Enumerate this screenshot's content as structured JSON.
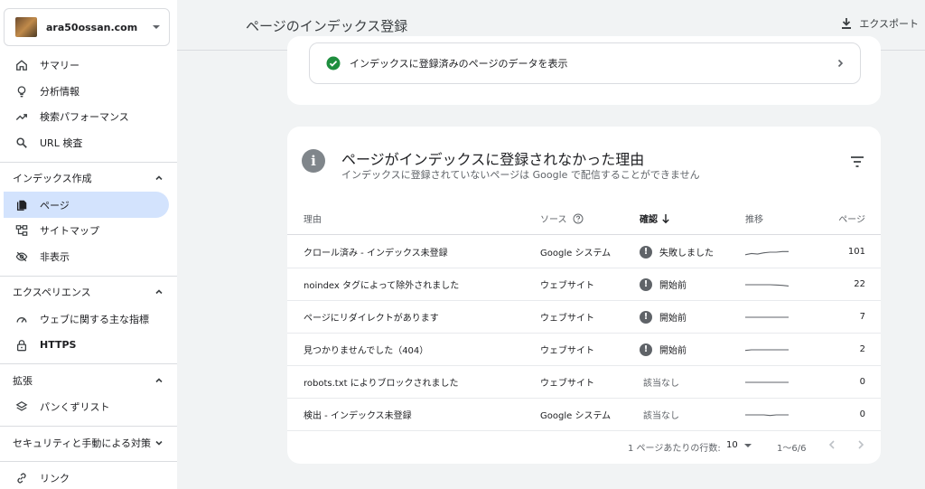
{
  "property": {
    "name": "ara50ossan.com"
  },
  "sidebar": {
    "items": [
      {
        "label": "サマリー",
        "icon": "home-icon"
      },
      {
        "label": "分析情報",
        "icon": "lightbulb-icon"
      },
      {
        "label": "検索パフォーマンス",
        "icon": "trending-up-icon"
      },
      {
        "label": "URL 検査",
        "icon": "search-icon"
      }
    ],
    "sections": [
      {
        "label": "インデックス作成",
        "items": [
          {
            "label": "ページ",
            "icon": "page-icon",
            "active": true
          },
          {
            "label": "サイトマップ",
            "icon": "sitemap-icon"
          },
          {
            "label": "非表示",
            "icon": "eye-off-icon"
          }
        ]
      },
      {
        "label": "エクスペリエンス",
        "items": [
          {
            "label": "ウェブに関する主な指標",
            "icon": "gauge-icon"
          },
          {
            "label": "HTTPS",
            "icon": "lock-icon"
          }
        ]
      },
      {
        "label": "拡張",
        "items": [
          {
            "label": "パンくずリスト",
            "icon": "layers-icon"
          }
        ]
      },
      {
        "label": "セキュリティと手動による対策",
        "items": []
      }
    ],
    "bottom_items": [
      {
        "label": "リンク",
        "icon": "link-icon"
      }
    ]
  },
  "header": {
    "title": "ページのインデックス登録",
    "export_label": "エクスポート"
  },
  "indexed_link": {
    "label": "インデックスに登録済みのページのデータを表示"
  },
  "reasons_card": {
    "title": "ページがインデックスに登録されなかった理由",
    "subtitle": "インデックスに登録されていないページは Google で配信することができません",
    "columns": {
      "reason": "理由",
      "source": "ソース",
      "status": "確認",
      "trend": "推移",
      "pages": "ページ"
    },
    "rows": [
      {
        "reason": "クロール済み - インデックス未登録",
        "source": "Google システム",
        "status": "失敗しました",
        "status_alert": true,
        "pages": "101",
        "trend": [
          0.3,
          0.4,
          0.35,
          0.45,
          0.5,
          0.5,
          0.55,
          0.55
        ]
      },
      {
        "reason": "noindex タグによって除外されました",
        "source": "ウェブサイト",
        "status": "開始前",
        "status_alert": true,
        "pages": "22",
        "trend": [
          0.5,
          0.5,
          0.5,
          0.5,
          0.5,
          0.48,
          0.45,
          0.4
        ]
      },
      {
        "reason": "ページにリダイレクトがあります",
        "source": "ウェブサイト",
        "status": "開始前",
        "status_alert": true,
        "pages": "7",
        "trend": [
          0.5,
          0.5,
          0.5,
          0.5,
          0.5,
          0.5,
          0.5,
          0.5
        ]
      },
      {
        "reason": "見つかりませんでした（404）",
        "source": "ウェブサイト",
        "status": "開始前",
        "status_alert": true,
        "pages": "2",
        "trend": [
          0.45,
          0.5,
          0.5,
          0.5,
          0.5,
          0.5,
          0.5,
          0.5
        ]
      },
      {
        "reason": "robots.txt によりブロックされました",
        "source": "ウェブサイト",
        "status": "該当なし",
        "status_alert": false,
        "pages": "0",
        "trend": [
          0.5,
          0.5,
          0.5,
          0.5,
          0.5,
          0.5,
          0.5,
          0.5
        ]
      },
      {
        "reason": "検出 - インデックス未登録",
        "source": "Google システム",
        "status": "該当なし",
        "status_alert": false,
        "pages": "0",
        "trend": [
          0.5,
          0.5,
          0.5,
          0.5,
          0.45,
          0.5,
          0.5,
          0.5
        ]
      }
    ],
    "pager": {
      "rows_per_page_label": "1 ページあたりの行数:",
      "rows_per_page": "10",
      "range": "1～6/6"
    }
  }
}
